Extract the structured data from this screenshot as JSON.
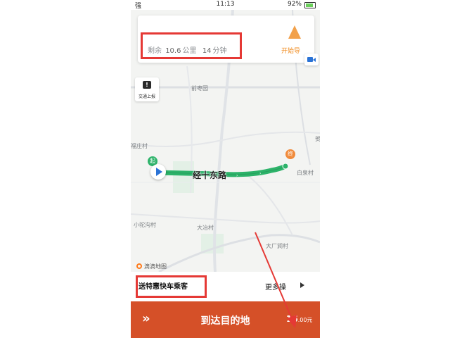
{
  "status_bar": {
    "signal": "强",
    "time": "11:13",
    "battery": "92%"
  },
  "route_card": {
    "remaining_prefix": "剩余",
    "distance_value": "10.6",
    "distance_unit": "公里",
    "time_value": "14",
    "time_unit": "分钟",
    "start_nav_label": "开始导"
  },
  "traffic_report": {
    "label": "交通上报",
    "icon": "exclamation-icon"
  },
  "map": {
    "places": {
      "qianlizhuang": "前枣园",
      "fuzhuangcun": "福庄村",
      "baiquancun": "白泉村",
      "xiaotuogou": "小驼沟村",
      "dazhicun": "大冶村",
      "daguangjian": "大厂涧村",
      "guan": "贺"
    },
    "road_name": "经十东路",
    "start_marker": "起",
    "end_marker": "终",
    "logo": "滴滴地图",
    "route_color": "#2db36a"
  },
  "actions": {
    "send_passenger": "送特惠快车乘客",
    "more": "更多操"
  },
  "bottom_bar": {
    "arrive": "到达目的地",
    "price_value": "16",
    "price_decimal": ".00元",
    "color": "#d55028"
  }
}
